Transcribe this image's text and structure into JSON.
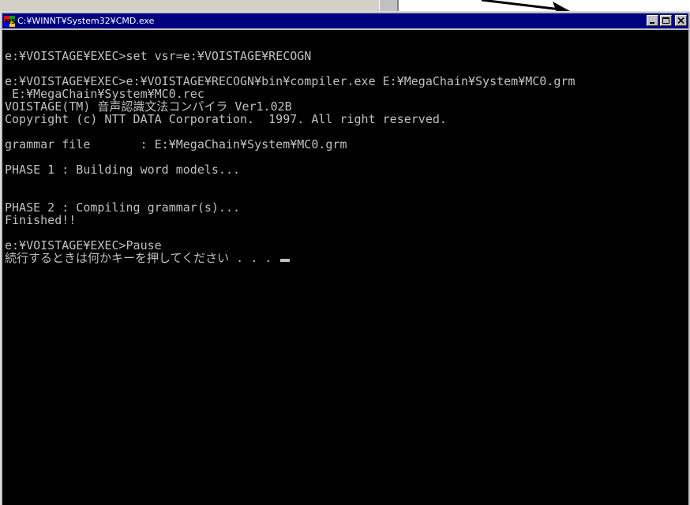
{
  "window": {
    "title": "C:¥WINNT¥System32¥CMD.exe",
    "app_icon": "ms-dos-icon",
    "controls": [
      "minimize-icon",
      "maximize-icon",
      "close-icon"
    ],
    "icon_label": "MS"
  },
  "console": {
    "lines": [
      "e:¥VOISTAGE¥EXEC>set vsr=e:¥VOISTAGE¥RECOGN",
      "",
      "e:¥VOISTAGE¥EXEC>e:¥VOISTAGE¥RECOGN¥bin¥compiler.exe E:¥MegaChain¥System¥MC0.grm",
      " E:¥MegaChain¥System¥MC0.rec",
      "VOISTAGE(TM) 音声認識文法コンパイラ Ver1.02B",
      "Copyright (c) NTT DATA Corporation.  1997. All right reserved.",
      "",
      "grammar file       : E:¥MegaChain¥System¥MC0.grm",
      "",
      "PHASE 1 : Building word models...",
      "",
      "",
      "PHASE 2 : Compiling grammar(s)...",
      "Finished!!",
      "",
      "e:¥VOISTAGE¥EXEC>Pause",
      "続行するときは何かキーを押してください . . . "
    ]
  },
  "colors": {
    "titlebar": "#000080",
    "console_bg": "#000000",
    "console_fg": "#c0c0c0"
  }
}
